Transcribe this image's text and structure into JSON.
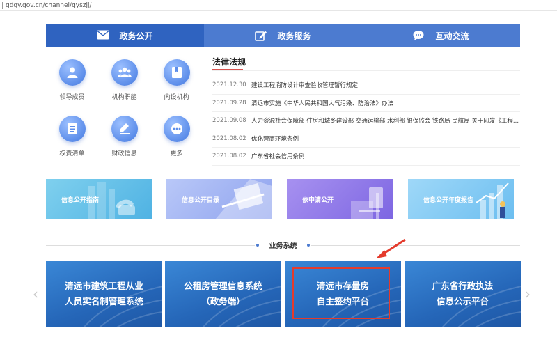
{
  "browser": {
    "url": "gdqy.gov.cn/channel/qyszjj/"
  },
  "nav": {
    "items": [
      {
        "label": "政务公开",
        "icon": "mail-icon"
      },
      {
        "label": "政务服务",
        "icon": "edit-icon"
      },
      {
        "label": "互动交流",
        "icon": "chat-icon"
      }
    ]
  },
  "quick_links": [
    {
      "label": "领导成员",
      "icon": "person-icon"
    },
    {
      "label": "机构职能",
      "icon": "group-icon"
    },
    {
      "label": "内设机构",
      "icon": "book-icon"
    },
    {
      "label": "权责清单",
      "icon": "list-icon"
    },
    {
      "label": "财政信息",
      "icon": "pen-icon"
    },
    {
      "label": "更多",
      "icon": "more-icon"
    }
  ],
  "law": {
    "title": "法律法规",
    "items": [
      {
        "date": "2021.12.30",
        "title": "建设工程消防设计审查验收管理暂行规定"
      },
      {
        "date": "2021.09.28",
        "title": "清远市实施《中华人民共和国大气污染、防治法》办法"
      },
      {
        "date": "2021.09.08",
        "title": "人力资源社会保障部 住房和城乡建设部 交通运输部 水利部 银保监会 铁路局 民航局 关于印发《工程..."
      },
      {
        "date": "2021.08.02",
        "title": "优化营商环境条例"
      },
      {
        "date": "2021.08.02",
        "title": "广东省社会信用条例"
      }
    ]
  },
  "banners": [
    {
      "label": "信息公开指南"
    },
    {
      "label": "信息公开目录"
    },
    {
      "label": "依申请公开"
    },
    {
      "label": "信息公开年度报告"
    }
  ],
  "business": {
    "heading": "业务系统",
    "cards": [
      {
        "line1": "清远市建筑工程从业",
        "line2": "人员实名制管理系统"
      },
      {
        "line1": "公租房管理信息系统",
        "line2": "（政务端）"
      },
      {
        "line1": "清远市存量房",
        "line2": "自主签约平台"
      },
      {
        "line1": "广东省行政执法",
        "line2": "信息公示平台"
      }
    ]
  },
  "carousel": {
    "prev": "‹",
    "next": "›"
  },
  "colors": {
    "nav": "#4c7bd0",
    "nav_active": "#2f63c0",
    "accent_red": "#e43b2c",
    "card_blue": "#2566b8"
  }
}
